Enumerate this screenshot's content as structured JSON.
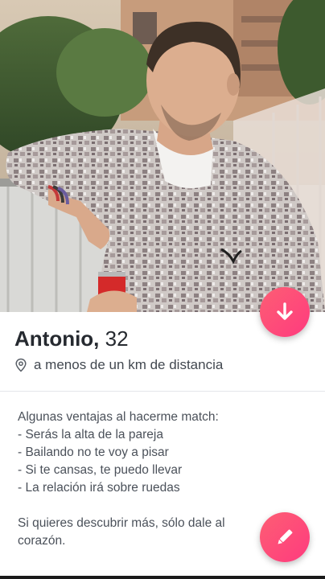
{
  "profile": {
    "name": "Antonio,",
    "age": "32",
    "distance": "a menos de un km de distancia"
  },
  "bio": {
    "lines": [
      "Algunas ventajas al hacerme match:",
      "- Serás la alta de la pareja",
      "- Bailando no te voy a pisar",
      "- Si te cansas, te puedo llevar",
      "- La relación irá sobre ruedas"
    ],
    "closing_lines": [
      "Si quieres descubrir más, sólo dale al",
      "corazón."
    ]
  },
  "icons": {
    "collapse": "arrow-down-icon",
    "edit": "pencil-icon",
    "location": "location-pin-icon"
  },
  "colors": {
    "accent": "#fd4a78",
    "text_primary": "#262a30",
    "text_secondary": "#4b515a"
  }
}
